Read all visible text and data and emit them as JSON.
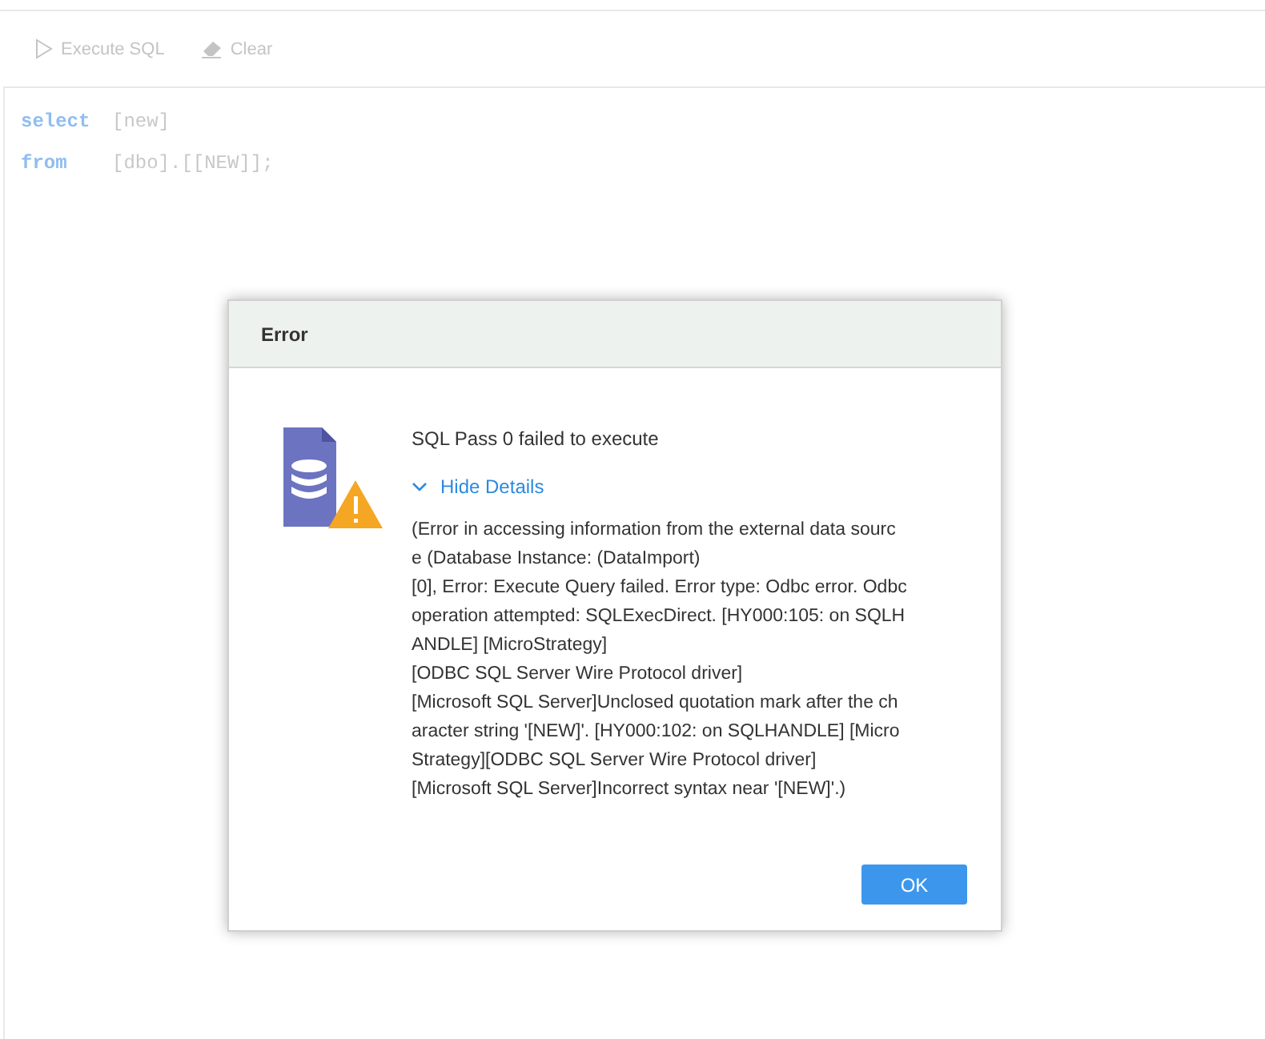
{
  "toolbar": [
    {
      "kind": "execute",
      "label": "Execute SQL",
      "disabled": true
    },
    {
      "kind": "clear",
      "label": "Clear",
      "disabled": true
    }
  ],
  "editor": {
    "lines": [
      {
        "keyword": "select",
        "rest": "[new]"
      },
      {
        "keyword": "from",
        "rest": "[dbo].[[NEW]];"
      }
    ]
  },
  "dialog": {
    "title": "Error",
    "message": "SQL Pass 0 failed to execute",
    "details_toggle": {
      "label": "Hide Details",
      "expanded": true
    },
    "details": [
      "(Error in accessing information from the external data sourc",
      "e (Database Instance: (DataImport)",
      "[0], Error: Execute Query failed. Error type: Odbc error. Odbc",
      "operation attempted: SQLExecDirect. [HY000:105: on SQLH",
      "ANDLE] [MicroStrategy]",
      "[ODBC SQL Server Wire Protocol driver]",
      "[Microsoft SQL Server]Unclosed quotation mark after the ch",
      "aracter string '[NEW]'. [HY000:102: on SQLHANDLE] [Micro",
      "Strategy][ODBC SQL Server Wire Protocol driver]",
      "[Microsoft SQL Server]Incorrect syntax near '[NEW]'.)"
    ],
    "buttons": [
      "OK"
    ]
  }
}
